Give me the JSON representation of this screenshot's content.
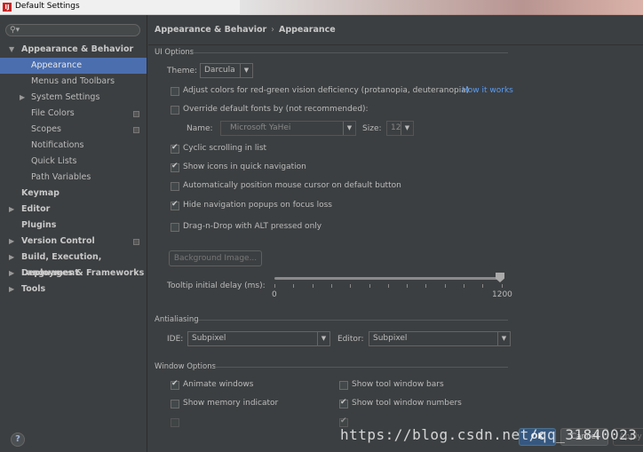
{
  "window": {
    "title": "Default Settings"
  },
  "search": {
    "placeholder": ""
  },
  "sidebar": {
    "items": [
      {
        "label": "Appearance & Behavior",
        "arrow": "▼",
        "bold": true
      },
      {
        "label": "Appearance",
        "selected": true
      },
      {
        "label": "Menus and Toolbars"
      },
      {
        "label": "System Settings",
        "arrow": "▶"
      },
      {
        "label": "File Colors",
        "project_icon": true
      },
      {
        "label": "Scopes",
        "project_icon": true
      },
      {
        "label": "Notifications"
      },
      {
        "label": "Quick Lists"
      },
      {
        "label": "Path Variables"
      },
      {
        "label": "Keymap",
        "bold": true
      },
      {
        "label": "Editor",
        "arrow": "▶",
        "bold": true
      },
      {
        "label": "Plugins",
        "bold": true
      },
      {
        "label": "Version Control",
        "arrow": "▶",
        "bold": true,
        "project_icon": true
      },
      {
        "label": "Build, Execution, Deployment",
        "arrow": "▶",
        "bold": true
      },
      {
        "label": "Languages & Frameworks",
        "arrow": "▶",
        "bold": true
      },
      {
        "label": "Tools",
        "arrow": "▶",
        "bold": true
      }
    ]
  },
  "breadcrumb": {
    "parent": "Appearance & Behavior",
    "separator": "›",
    "current": "Appearance"
  },
  "ui_options": {
    "section_title": "UI Options",
    "theme_label": "Theme:",
    "theme_value": "Darcula",
    "adjust_colors_label": "Adjust colors for red-green vision deficiency (protanopia, deuteranopia)",
    "adjust_colors_checked": false,
    "how_it_works_link": "How it works",
    "override_fonts_label": "Override default fonts by (not recommended):",
    "override_fonts_checked": false,
    "name_label": "Name:",
    "name_value": "Microsoft YaHei",
    "size_label": "Size:",
    "size_value": "12",
    "cyclic_scrolling_label": "Cyclic scrolling in list",
    "cyclic_scrolling_checked": true,
    "show_icons_label": "Show icons in quick navigation",
    "show_icons_checked": true,
    "auto_position_label": "Automatically position mouse cursor on default button",
    "auto_position_checked": false,
    "hide_nav_popups_label": "Hide navigation popups on focus loss",
    "hide_nav_popups_checked": true,
    "drag_drop_label": "Drag-n-Drop with ALT pressed only",
    "drag_drop_checked": false,
    "background_image_button": "Background Image...",
    "tooltip_delay_label": "Tooltip initial delay (ms):",
    "tooltip_min": "0",
    "tooltip_max": "1200",
    "tooltip_value": 1200
  },
  "antialiasing": {
    "section_title": "Antialiasing",
    "ide_label": "IDE:",
    "ide_value": "Subpixel",
    "editor_label": "Editor:",
    "editor_value": "Subpixel"
  },
  "window_options": {
    "section_title": "Window Options",
    "animate_windows_label": "Animate windows",
    "animate_windows_checked": true,
    "show_tool_bars_label": "Show tool window bars",
    "show_tool_bars_checked": false,
    "show_memory_label": "Show memory indicator",
    "show_memory_checked": false,
    "show_tool_numbers_label": "Show tool window numbers",
    "show_tool_numbers_checked": true
  },
  "footer": {
    "help_label": "?",
    "ok_label": "OK",
    "cancel_label": "Cancel",
    "apply_label": "Apply"
  },
  "watermark": "https://blog.csdn.net/qq_31840023",
  "colors": {
    "background": "#3c3f41",
    "selection": "#4b6eaf",
    "link": "#589df6",
    "ok_button": "#365880"
  }
}
